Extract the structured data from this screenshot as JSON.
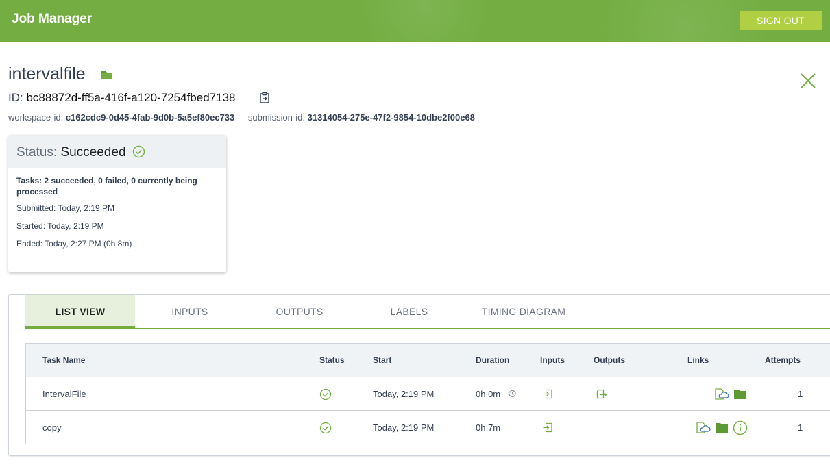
{
  "header": {
    "app_title": "Job Manager",
    "sign_out_label": "SIGN OUT",
    "color": "#74ae43",
    "button_color": "#b1cf43"
  },
  "job": {
    "name": "intervalfile",
    "id_label": "ID:",
    "id": "bc88872d-ff5a-416f-a120-7254fbed7138",
    "workspace_label": "workspace-id:",
    "workspace_id": "c162cdc9-0d45-4fab-9d0b-5a5ef80ec733",
    "submission_label": "submission-id:",
    "submission_id": "31314054-275e-47f2-9854-10dbe2f00e68"
  },
  "status": {
    "label": "Status:",
    "value": "Succeeded",
    "tasks_summary": "Tasks: 2 succeeded, 0 failed, 0 currently being processed",
    "submitted": "Submitted: Today, 2:19 PM",
    "started": "Started: Today, 2:19 PM",
    "ended": "Ended: Today, 2:27 PM (0h 8m)"
  },
  "tabs": [
    {
      "label": "LIST VIEW",
      "active": true
    },
    {
      "label": "INPUTS",
      "active": false
    },
    {
      "label": "OUTPUTS",
      "active": false
    },
    {
      "label": "LABELS",
      "active": false
    },
    {
      "label": "TIMING DIAGRAM",
      "active": false
    }
  ],
  "table": {
    "columns": [
      "Task Name",
      "Status",
      "Start",
      "Duration",
      "Inputs",
      "Outputs",
      "Links",
      "Attempts"
    ],
    "rows": [
      {
        "task_name": "IntervalFile",
        "status_icon": "check-circle-icon",
        "start": "Today, 2:19 PM",
        "duration": "0h 0m",
        "attempts": "1"
      },
      {
        "task_name": "copy",
        "status_icon": "check-circle-icon",
        "start": "Today, 2:19 PM",
        "duration": "0h 7m",
        "attempts": "1"
      }
    ]
  }
}
